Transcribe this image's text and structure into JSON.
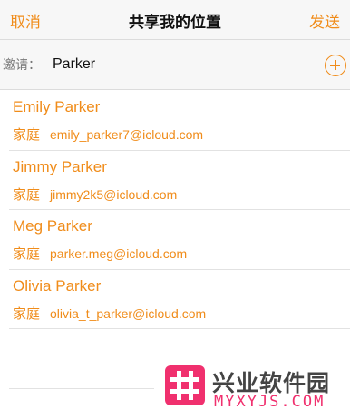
{
  "navbar": {
    "cancel_label": "取消",
    "title": "共享我的位置",
    "send_label": "发送"
  },
  "invite": {
    "label": "邀请：",
    "value": "Parker"
  },
  "contacts": [
    {
      "name": "Emily Parker",
      "type": "家庭",
      "email": "emily_parker7@icloud.com"
    },
    {
      "name": "Jimmy Parker",
      "type": "家庭",
      "email": "jimmy2k5@icloud.com"
    },
    {
      "name": "Meg Parker",
      "type": "家庭",
      "email": "parker.meg@icloud.com"
    },
    {
      "name": "Olivia Parker",
      "type": "家庭",
      "email": "olivia_t_parker@icloud.com"
    }
  ],
  "watermark": {
    "cn": "兴业软件园",
    "en": "MYXYJS.COM"
  },
  "colors": {
    "accent": "#f08c1a",
    "watermark": "#f0306e"
  },
  "icons": {
    "add": "plus-circle-icon",
    "logo": "hash-logo-icon"
  }
}
